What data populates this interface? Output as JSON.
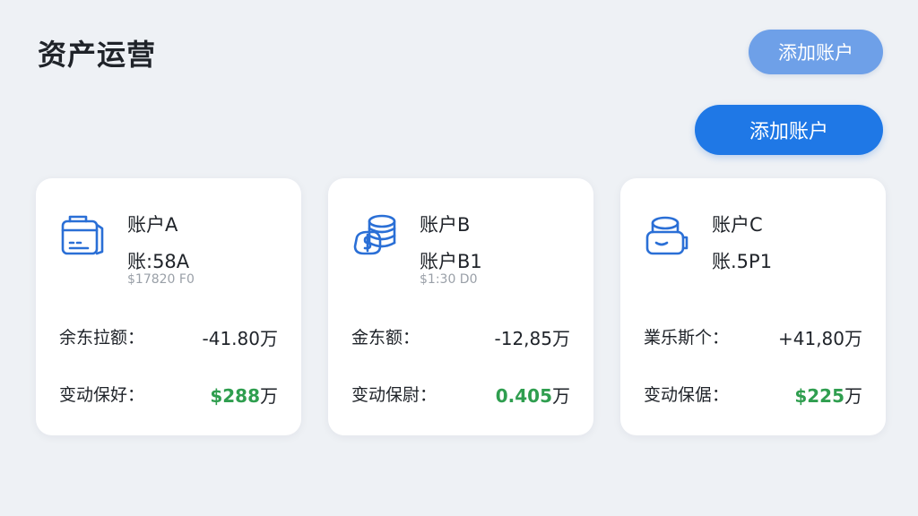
{
  "header": {
    "title": "资产运营",
    "add_button_top": "添加账户",
    "add_button_main": "添加账户"
  },
  "cards": [
    {
      "icon": "folder-card-icon",
      "name": "账户A",
      "sub": "账:58A",
      "faint": "$17820 F0",
      "row1_label": "余东拉额：",
      "row1_value": "-41.80万",
      "row2_label": "变动保好：",
      "row2_value": "$288",
      "row2_unit": "万"
    },
    {
      "icon": "coins-dollar-icon",
      "name": "账户B",
      "sub": "账户B1",
      "faint": "$1:30 D0",
      "row1_label": "金东额：",
      "row1_value": "-12,85万",
      "row2_label": "变动保尉：",
      "row2_value": "0.405",
      "row2_unit": "万"
    },
    {
      "icon": "wallet-cylinder-icon",
      "name": "账户C",
      "sub": "账.5P1",
      "faint": "",
      "row1_label": "業乐斯个：",
      "row1_value": "+41,80万",
      "row2_label": "变动保倨：",
      "row2_value": "$225",
      "row2_unit": "万"
    }
  ],
  "colors": {
    "accent": "#1f78e6",
    "accent_light": "#6ea0e8",
    "positive": "#2f9e4f",
    "background": "#eef1f5"
  }
}
